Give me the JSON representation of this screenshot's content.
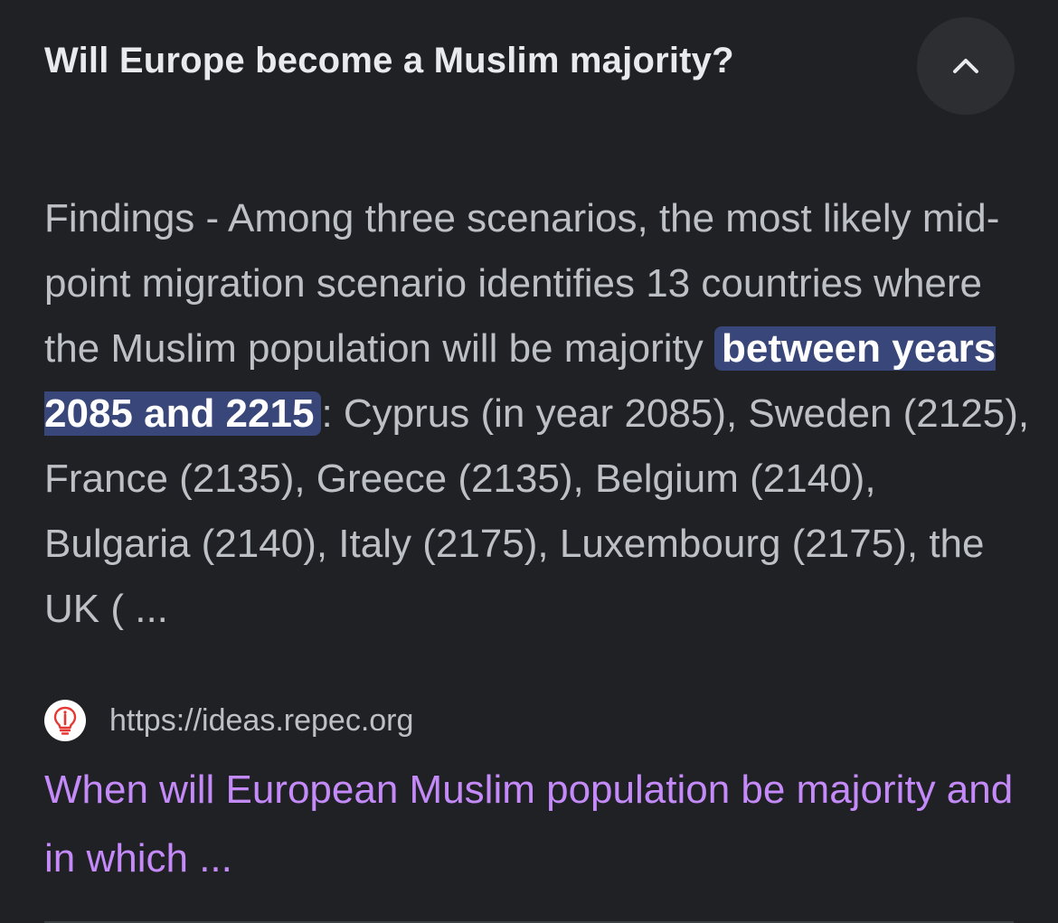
{
  "question": {
    "title": "Will Europe become a Muslim majority?",
    "toggle_icon": "chevron-up-icon"
  },
  "snippet": {
    "before_highlight": "Findings - Among three scenarios, the most likely mid-point migration scenario identifies 13 countries where the Muslim population will be majority ",
    "highlight": "between years 2085 and 2215",
    "after_highlight": ": Cyprus (in year 2085), Sweden (2125), France (2135), Greece (2135), Belgium (2140), Bulgaria (2140), Italy (2175), Luxembourg (2175), the UK ( ..."
  },
  "source": {
    "favicon_icon": "lightbulb-icon",
    "url": "https://ideas.repec.org"
  },
  "result": {
    "title": "When will European Muslim population be majority and in which ..."
  },
  "colors": {
    "background": "#202124",
    "title_text": "#e8eaed",
    "body_text": "#bdc1c6",
    "highlight_bg": "#394679",
    "link_visited": "#c58af9",
    "favicon_red": "#e53935"
  }
}
